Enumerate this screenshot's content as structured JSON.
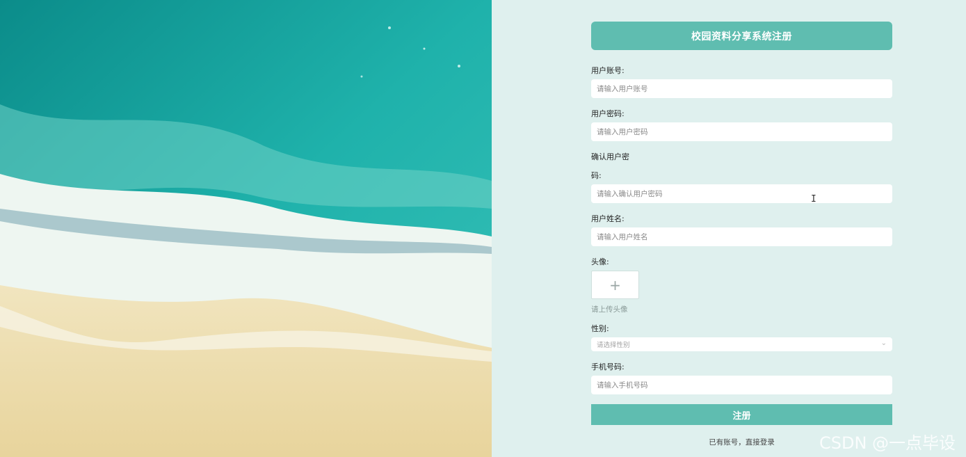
{
  "form": {
    "title": "校园资料分享系统注册",
    "fields": {
      "account": {
        "label": "用户账号:",
        "placeholder": "请输入用户账号"
      },
      "password": {
        "label": "用户密码:",
        "placeholder": "请输入用户密码"
      },
      "confirm": {
        "label_line1": "确认用户密",
        "label_line2": "码:",
        "placeholder": "请输入确认用户密码"
      },
      "name": {
        "label": "用户姓名:",
        "placeholder": "请输入用户姓名"
      },
      "avatar": {
        "label": "头像:",
        "plus": "+",
        "hint": "请上传头像"
      },
      "gender": {
        "label": "性别:",
        "placeholder": "请选择性别",
        "chevron": "⌄"
      },
      "phone": {
        "label": "手机号码:",
        "placeholder": "请输入手机号码"
      }
    },
    "submit_label": "注册",
    "login_link": "已有账号，直接登录"
  },
  "watermark": "CSDN @一点毕设",
  "cursor_glyph": "I",
  "colors": {
    "accent": "#5fbdb0",
    "panel_bg": "#dff0ee"
  },
  "icons": {
    "upload": "plus-icon",
    "select": "chevron-down-icon"
  }
}
